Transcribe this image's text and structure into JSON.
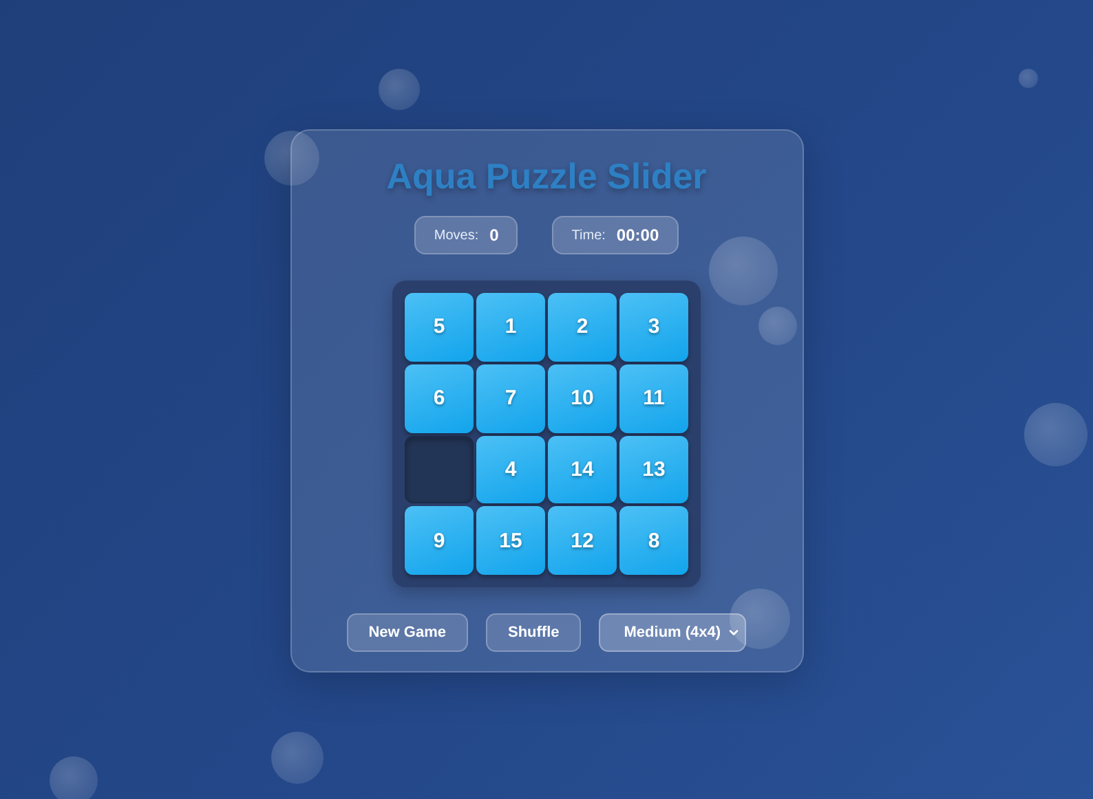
{
  "title": "Aqua Puzzle Slider",
  "stats": [
    {
      "label": "Moves:",
      "value": "0"
    },
    {
      "label": "Time:",
      "value": "00:00"
    }
  ],
  "tiles": [
    {
      "kind": "tile",
      "label": "5"
    },
    {
      "kind": "tile",
      "label": "1"
    },
    {
      "kind": "tile",
      "label": "2"
    },
    {
      "kind": "tile",
      "label": "3"
    },
    {
      "kind": "tile",
      "label": "6"
    },
    {
      "kind": "tile",
      "label": "7"
    },
    {
      "kind": "tile",
      "label": "10"
    },
    {
      "kind": "tile",
      "label": "11"
    },
    {
      "kind": "empty"
    },
    {
      "kind": "tile",
      "label": "4"
    },
    {
      "kind": "tile",
      "label": "14"
    },
    {
      "kind": "tile",
      "label": "13"
    },
    {
      "kind": "tile",
      "label": "9"
    },
    {
      "kind": "tile",
      "label": "15"
    },
    {
      "kind": "tile",
      "label": "12"
    },
    {
      "kind": "tile",
      "label": "8"
    }
  ],
  "buttons": [
    "New Game",
    "Shuffle"
  ],
  "difficulty": {
    "value": "Medium (4x4)"
  }
}
